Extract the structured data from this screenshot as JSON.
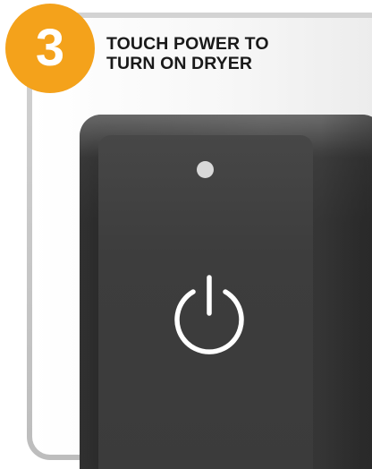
{
  "step": {
    "number": "3"
  },
  "instruction": {
    "line1": "TOUCH POWER TO",
    "line2": "TURN ON DRYER"
  },
  "control": {
    "led_icon": "indicator-light-icon",
    "power_icon": "power-icon"
  },
  "colors": {
    "badge": "#f4a21b",
    "badge_text": "#ffffff",
    "instruction_text": "#1a1a1a",
    "panel_frame": "#c8c8c8",
    "housing": "#2f2f2f",
    "button_face": "#3d3d3d",
    "icon": "#ffffff"
  }
}
